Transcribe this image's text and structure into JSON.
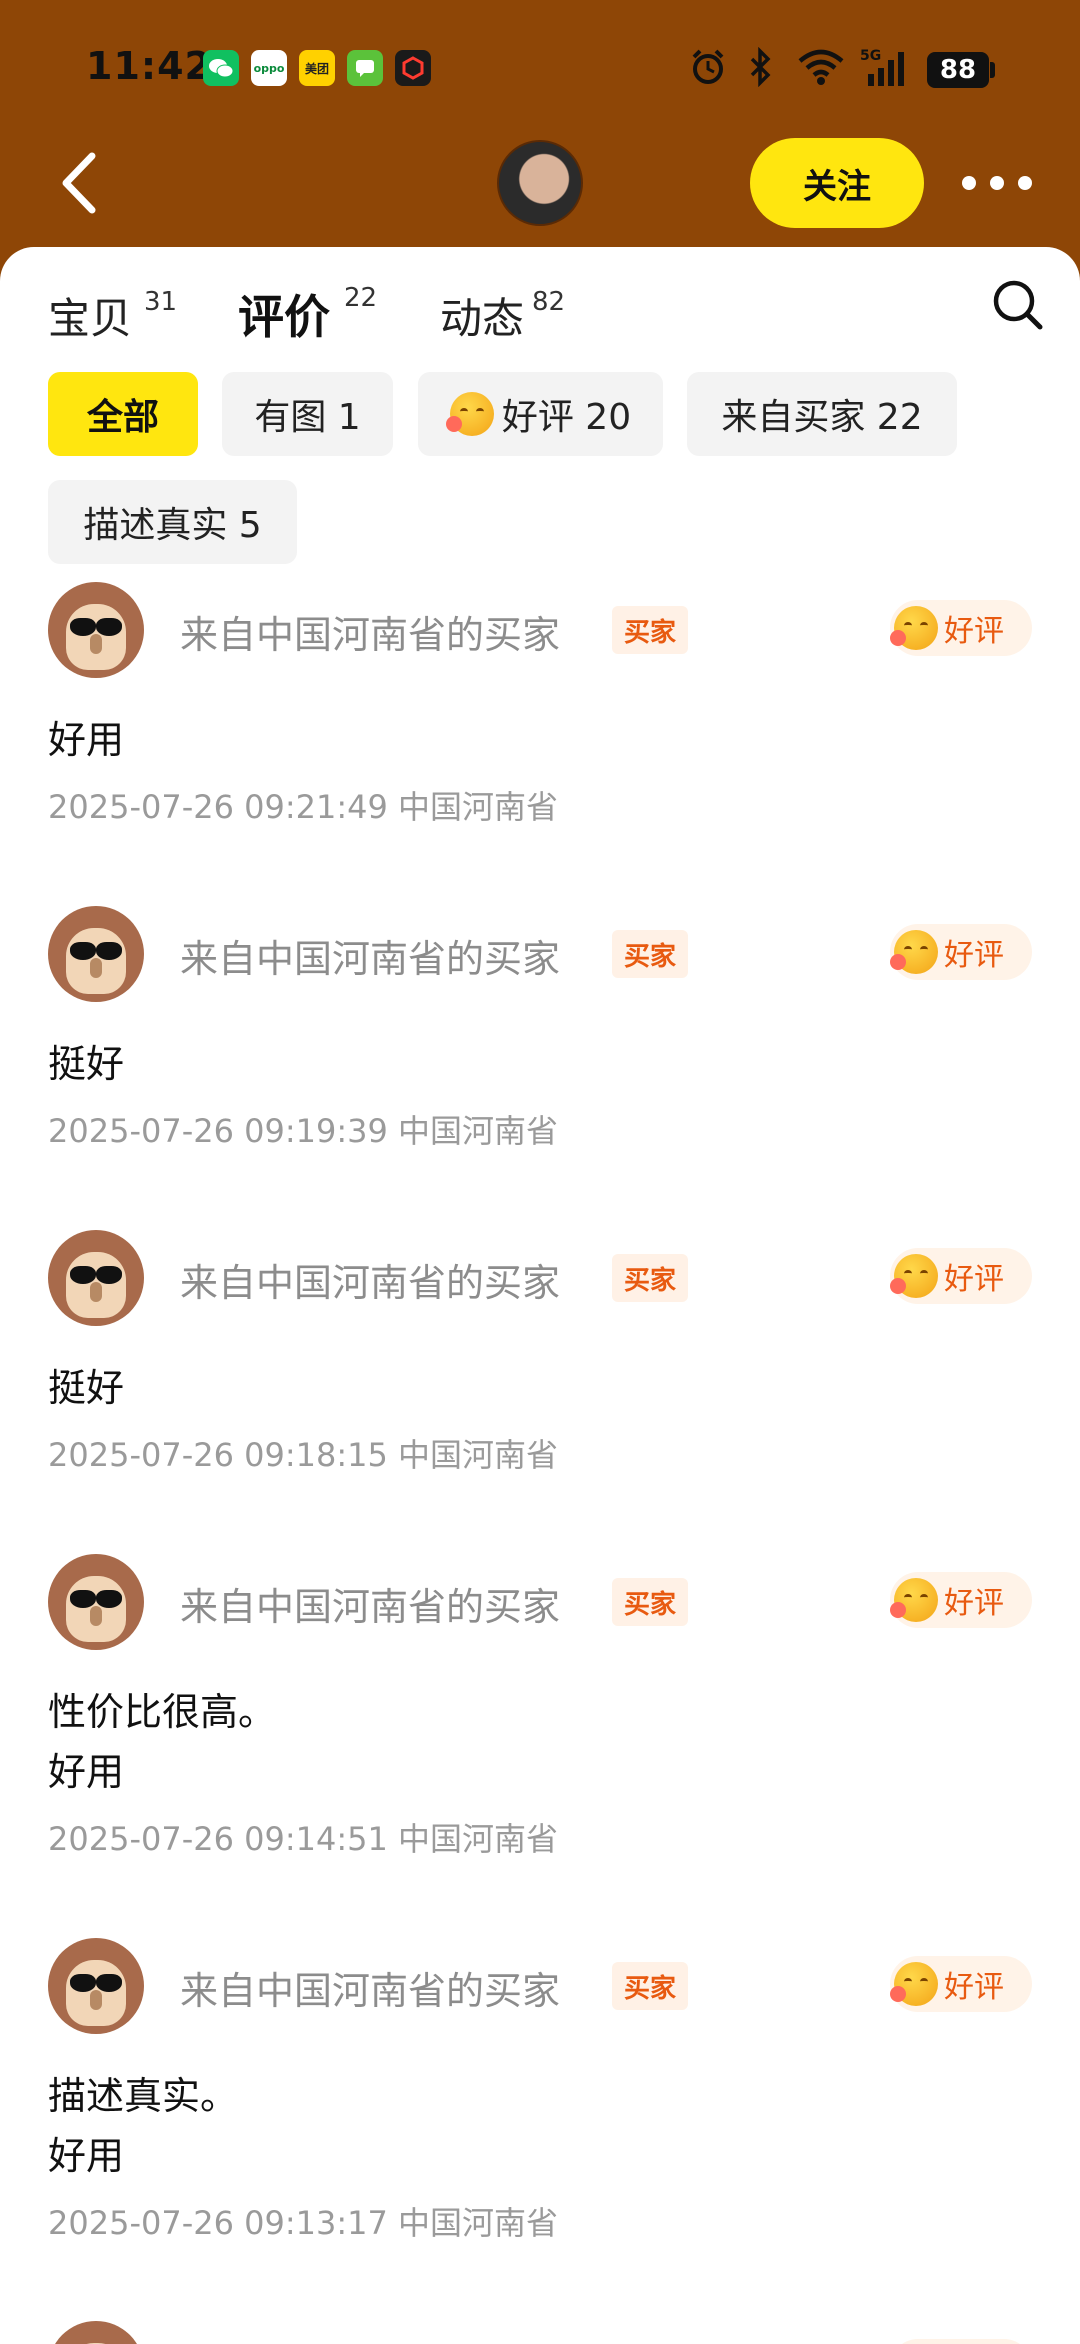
{
  "status_bar": {
    "time": "11:42",
    "notifications": [
      "wechat",
      "oppo",
      "美团",
      "messages",
      "app"
    ],
    "notif_labels": {
      "oppo": "oppo",
      "meituan": "美团"
    },
    "battery": "88",
    "network": "5G"
  },
  "header": {
    "follow_label": "关注"
  },
  "tabs": [
    {
      "label": "宝贝",
      "count": "31"
    },
    {
      "label": "评价",
      "count": "22"
    },
    {
      "label": "动态",
      "count": "82"
    }
  ],
  "filters": {
    "all": "全部",
    "with_image": "有图 1",
    "good": "好评 20",
    "from_buyer": "来自买家 22",
    "accurate": "描述真实 5"
  },
  "reviews": [
    {
      "name": "来自中国河南省的买家",
      "badge": "买家",
      "rating": "好评",
      "text": "好用",
      "meta": "2025-07-26 09:21:49 中国河南省"
    },
    {
      "name": "来自中国河南省的买家",
      "badge": "买家",
      "rating": "好评",
      "text": "挺好",
      "meta": "2025-07-26 09:19:39 中国河南省"
    },
    {
      "name": "来自中国河南省的买家",
      "badge": "买家",
      "rating": "好评",
      "text": "挺好",
      "meta": "2025-07-26 09:18:15 中国河南省"
    },
    {
      "name": "来自中国河南省的买家",
      "badge": "买家",
      "rating": "好评",
      "text_lines": [
        "性价比很高。",
        "好用"
      ],
      "meta": "2025-07-26 09:14:51 中国河南省"
    },
    {
      "name": "来自中国河南省的买家",
      "badge": "买家",
      "rating": "好评",
      "text_lines": [
        "描述真实。",
        "好用"
      ],
      "meta": "2025-07-26 09:13:17 中国河南省"
    }
  ],
  "colors": {
    "header_bg": "#8e4606",
    "accent_yellow": "#ffe60f",
    "badge_orange": "#e85a10"
  }
}
